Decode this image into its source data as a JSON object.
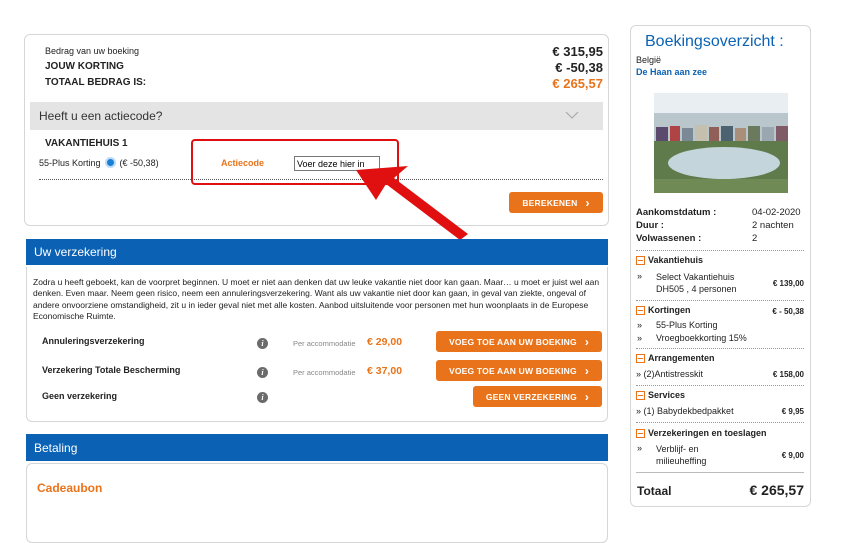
{
  "summary": {
    "amount_label": "Bedrag van uw boeking",
    "amount_value": "€ 315,95",
    "discount_label": "JOUW KORTING",
    "discount_value": "€ -50,38",
    "total_label": "TOTAAL BEDRAG IS:",
    "total_value": "€ 265,57"
  },
  "action_code": {
    "header": "Heeft u een actiecode?",
    "house_title": "VAKANTIEHUIS 1",
    "discount_line": "55-Plus Korting",
    "discount_amount": "(€ -50,38)",
    "code_label": "Actiecode",
    "code_input_value": "Voer deze hier in",
    "calculate_button": "BEREKENEN"
  },
  "insurance": {
    "title": "Uw verzekering",
    "intro": "Zodra u heeft geboekt, kan de voorpret beginnen. U moet er niet aan denken dat uw leuke vakantie niet door kan gaan. Maar… u moet er juist wel aan denken. Even maar. Neem geen risico, neem een annuleringsverzekering. Want als uw vakantie niet door kan gaan, in geval van ziekte, ongeval of andere onvoorziene omstandigheid, zit u in ieder geval niet met alle kosten. Aanbod uitsluitende voor personen met hun woonplaats in de Europese Economische Ruimte.",
    "options": [
      {
        "name": "Annuleringsverzekering",
        "per": "Per accommodatie",
        "price": "€ 29,00",
        "button": "VOEG TOE AAN UW BOEKING"
      },
      {
        "name": "Verzekering Totale Bescherming",
        "per": "Per accommodatie",
        "price": "€ 37,00",
        "button": "VOEG TOE AAN UW BOEKING"
      },
      {
        "name": "Geen verzekering",
        "button": "GEEN VERZEKERING"
      }
    ]
  },
  "payment": {
    "title": "Betaling",
    "voucher": "Cadeaubon"
  },
  "sidebar": {
    "title": "Boekingsoverzicht :",
    "country": "België",
    "location": "De Haan aan zee",
    "arrival_label": "Aankomstdatum :",
    "arrival_value": "04-02-2020",
    "duration_label": "Duur :",
    "duration_value": "2 nachten",
    "adults_label": "Volwassenen :",
    "adults_value": "2",
    "sections": {
      "house": {
        "title": "Vakantiehuis",
        "item": "Select Vakantiehuis DH505 , 4 personen",
        "price": "€ 139,00"
      },
      "discounts": {
        "title": "Kortingen",
        "price": "€ - 50,38",
        "item1": "55-Plus Korting",
        "item2": "Vroegboekkorting 15%"
      },
      "arrangements": {
        "title": "Arrangementen",
        "item": "» (2)Antistresskit",
        "price": "€ 158,00"
      },
      "services": {
        "title": "Services",
        "item": "» (1) Babydekbedpakket",
        "price": "€ 9,95"
      },
      "insurances": {
        "title": "Verzekeringen en toeslagen",
        "item": "Verblijf- en milieuheffing",
        "price": "€ 9,00"
      }
    },
    "total_label": "Totaal",
    "total_value": "€ 265,57"
  },
  "colors": {
    "accent": "#e8731a",
    "brand_blue": "#0b62b4",
    "annotation_red": "#e01010"
  }
}
